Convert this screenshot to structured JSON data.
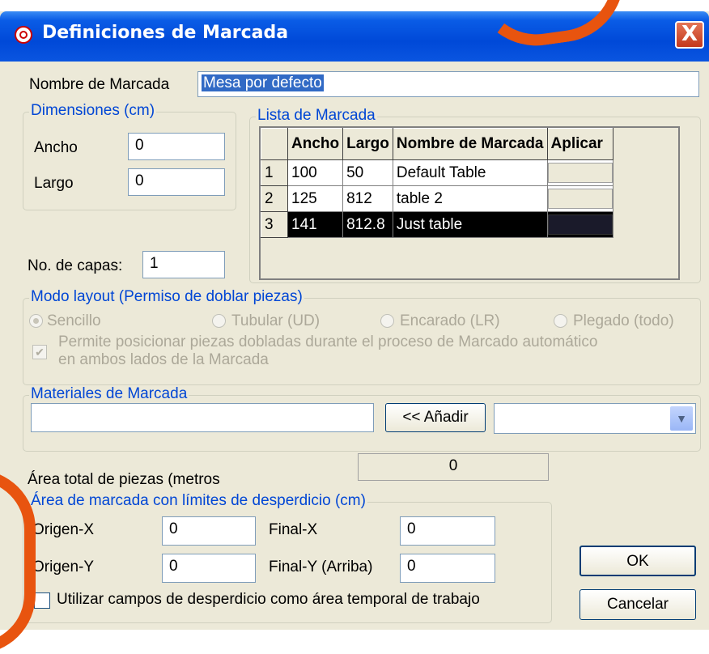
{
  "window": {
    "title": "Definiciones de Marcada",
    "close_label": "X"
  },
  "name_field": {
    "label": "Nombre de Marcada",
    "value": "Mesa por defecto"
  },
  "dimensions": {
    "legend": "Dimensiones (cm)",
    "width_label": "Ancho",
    "width_value": "0",
    "length_label": "Largo",
    "length_value": "0"
  },
  "layers": {
    "label": "No. de capas:",
    "value": "1"
  },
  "marker_list": {
    "legend": "Lista de Marcada",
    "columns": [
      "Ancho",
      "Largo",
      "Nombre de Marcada",
      "Aplicar"
    ],
    "rows": [
      {
        "num": "1",
        "ancho": "100",
        "largo": "50",
        "nombre": "Default Table"
      },
      {
        "num": "2",
        "ancho": "125",
        "largo": "812",
        "nombre": "table 2"
      },
      {
        "num": "3",
        "ancho": "141",
        "largo": "812.8",
        "nombre": "Just table"
      }
    ],
    "selected_row": 3
  },
  "layout_mode": {
    "legend": "Modo layout (Permiso de doblar piezas)",
    "options": [
      "Sencillo",
      "Tubular (UD)",
      "Encarado (LR)",
      "Plegado (todo)"
    ],
    "selected": "Sencillo",
    "fold_check_line1": "Permite posicionar piezas dobladas durante el proceso de Marcado automático",
    "fold_check_line2": "en ambos lados de la Marcada",
    "fold_checked": true
  },
  "materials": {
    "legend": "Materiales de Marcada",
    "input_value": "",
    "add_label": "<< Añadir",
    "select_value": ""
  },
  "total_area": {
    "label": "Área total de piezas (metros",
    "value": "0"
  },
  "waste_area": {
    "legend": "Área de marcada con límites de desperdicio (cm)",
    "origin_x_label": "Origen-X",
    "origin_x_value": "0",
    "final_x_label": "Final-X",
    "final_x_value": "0",
    "origin_y_label": "Origen-Y",
    "origin_y_value": "0",
    "final_y_label": "Final-Y (Arriba)",
    "final_y_value": "0",
    "checkbox_label": "Utilizar campos de desperdicio como área temporal de trabajo",
    "checked": false
  },
  "buttons": {
    "ok": "OK",
    "cancel": "Cancelar"
  },
  "colors": {
    "titlebar": "#0a55e0",
    "legend_text": "#0046d5",
    "dialog_bg": "#ece9d8",
    "selection": "#000000"
  }
}
